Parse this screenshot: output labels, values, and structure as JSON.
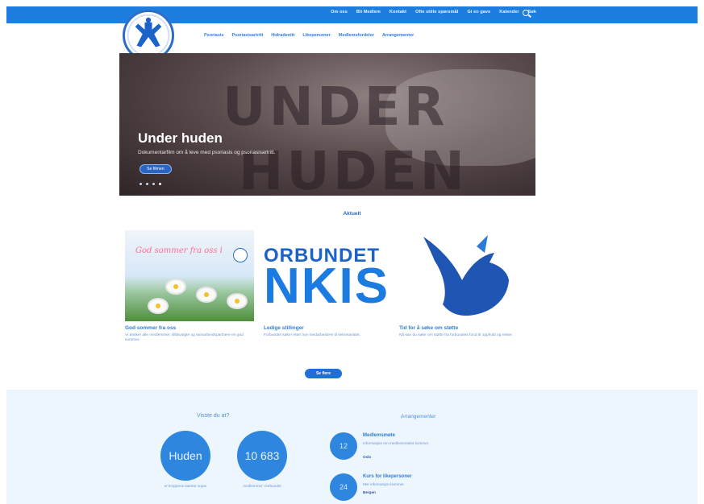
{
  "topnav": {
    "items": [
      "Om oss",
      "Bli Medlem",
      "Kontakt",
      "Ofte stilte spørsmål",
      "Gi en gave",
      "Kalender",
      "Søk"
    ],
    "search_icon": "search-icon",
    "color": "#1e7ee0"
  },
  "logo": {
    "name": "psoriasis-forbundet-logo"
  },
  "mainnav": {
    "items": [
      "Psoriasis",
      "Psoriasisartritt",
      "Hidradenitt",
      "Likepersoner",
      "Medlemsfordeler",
      "Arrangementer"
    ]
  },
  "hero": {
    "background_text_1": "UNDER",
    "background_text_2": "HUDEN",
    "title": "Under huden",
    "subtitle": "Dokumentarfilm om å leve med psoriasis og psoriasisartritt.",
    "cta_label": "Se filmen",
    "slides": 4,
    "active_slide": 4
  },
  "aktuelt": {
    "heading": "Aktuelt"
  },
  "cards": [
    {
      "image_text": "God sommer fra oss i",
      "title": "God sommer fra oss",
      "text": "Vi ønsker alle medlemmer, tillitsvalgte og samarbeidspartnere en god sommer."
    },
    {
      "image_text_1": "ORBUNDET",
      "image_text_2": "NKIS",
      "title": "Ledige stillinger",
      "text": "Forbundet søker etter nye medarbeidere til sekretariatet."
    },
    {
      "image": "blue-bird",
      "title": "Tid for å søke om støtte",
      "text": "Nå kan du søke om støtte fra forbundets fond til opphold og reiser."
    }
  ],
  "more_button": {
    "label": "Se flere"
  },
  "stats": {
    "heading": "Visste du at?",
    "items": [
      {
        "value": "Huden",
        "caption": "er kroppens største organ"
      },
      {
        "value": "10 683",
        "caption": "medlemmer i forbundet"
      }
    ]
  },
  "events": {
    "heading": "Arrangementer",
    "items": [
      {
        "date": "12",
        "title": "Medlemsmøte",
        "text": "Informasjon om medlemsmøtet kommer.",
        "place": "Oslo"
      },
      {
        "date": "24",
        "title": "Kurs for likepersoner",
        "text": "Mer informasjon kommer.",
        "place": "Bergen"
      }
    ]
  },
  "colors": {
    "accent": "#1e7ee0",
    "text_blue": "#2f7fd6",
    "circle_blue": "#2f86de",
    "lower_bg": "#eef6fd"
  }
}
